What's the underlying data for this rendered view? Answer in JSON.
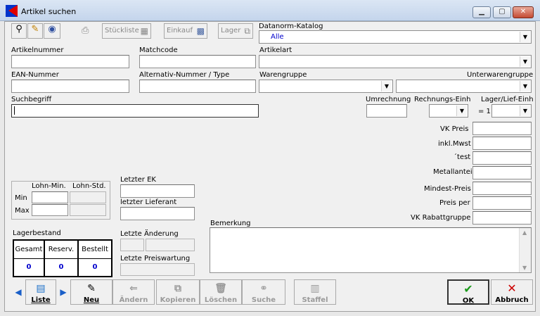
{
  "window": {
    "title": "Artikel suchen",
    "minimize": "▁",
    "maximize": "▢",
    "close": "✕"
  },
  "toolbar": {
    "stueckliste": "Stückliste",
    "einkauf": "Einkauf",
    "lager": "Lager"
  },
  "datanorm": {
    "label": "Datanorm-Katalog",
    "value": "Alle"
  },
  "fields": {
    "artikelnummer": "Artikelnummer",
    "matchcode": "Matchcode",
    "artikelart": "Artikelart",
    "ean": "EAN-Nummer",
    "alternativ": "Alternativ-Nummer / Type",
    "warengruppe": "Warengruppe",
    "unterwarengruppe": "Unterwarengruppe",
    "suchbegriff": "Suchbegriff",
    "umrechnung": "Umrechnung",
    "rechnungs_einh": "Rechnungs-Einh",
    "lager_lief_einh": "Lager/Lief-Einh",
    "eq1": "= 1"
  },
  "prices": {
    "vk_preis": "VK Preis",
    "inkl_mwst": "inkl.Mwst",
    "test": "´test",
    "metallanteil": "Metallanteil",
    "mindest": "Mindest-Preis",
    "preis_per": "Preis per",
    "vk_rabattgruppe": "VK Rabattgruppe"
  },
  "lohn": {
    "min_col": "Lohn-Min.",
    "std_col": "Lohn-Std.",
    "min_row": "Min",
    "max_row": "Max"
  },
  "ek": {
    "letzter_ek": "Letzter EK",
    "letzter_lieferant": "letzter Lieferant",
    "letzte_aenderung": "Letzte Änderung",
    "letzte_preiswartung": "Letzte Preiswartung"
  },
  "lager": {
    "title": "Lagerbestand",
    "headers": [
      "Gesamt",
      "Reserv.",
      "Bestellt"
    ],
    "values": [
      "0",
      "0",
      "0"
    ]
  },
  "bemerkung": "Bemerkung",
  "buttons": {
    "liste": "Liste",
    "neu": "Neu",
    "aendern": "Ändern",
    "kopieren": "Kopieren",
    "loeschen": "Löschen",
    "suche": "Suche",
    "staffel": "Staffel",
    "ok": "OK",
    "abbruch": "Abbruch"
  },
  "colors": {
    "accent_blue": "#0000cc",
    "ok_green": "#1a9a1a",
    "cancel_red": "#cc0000"
  }
}
